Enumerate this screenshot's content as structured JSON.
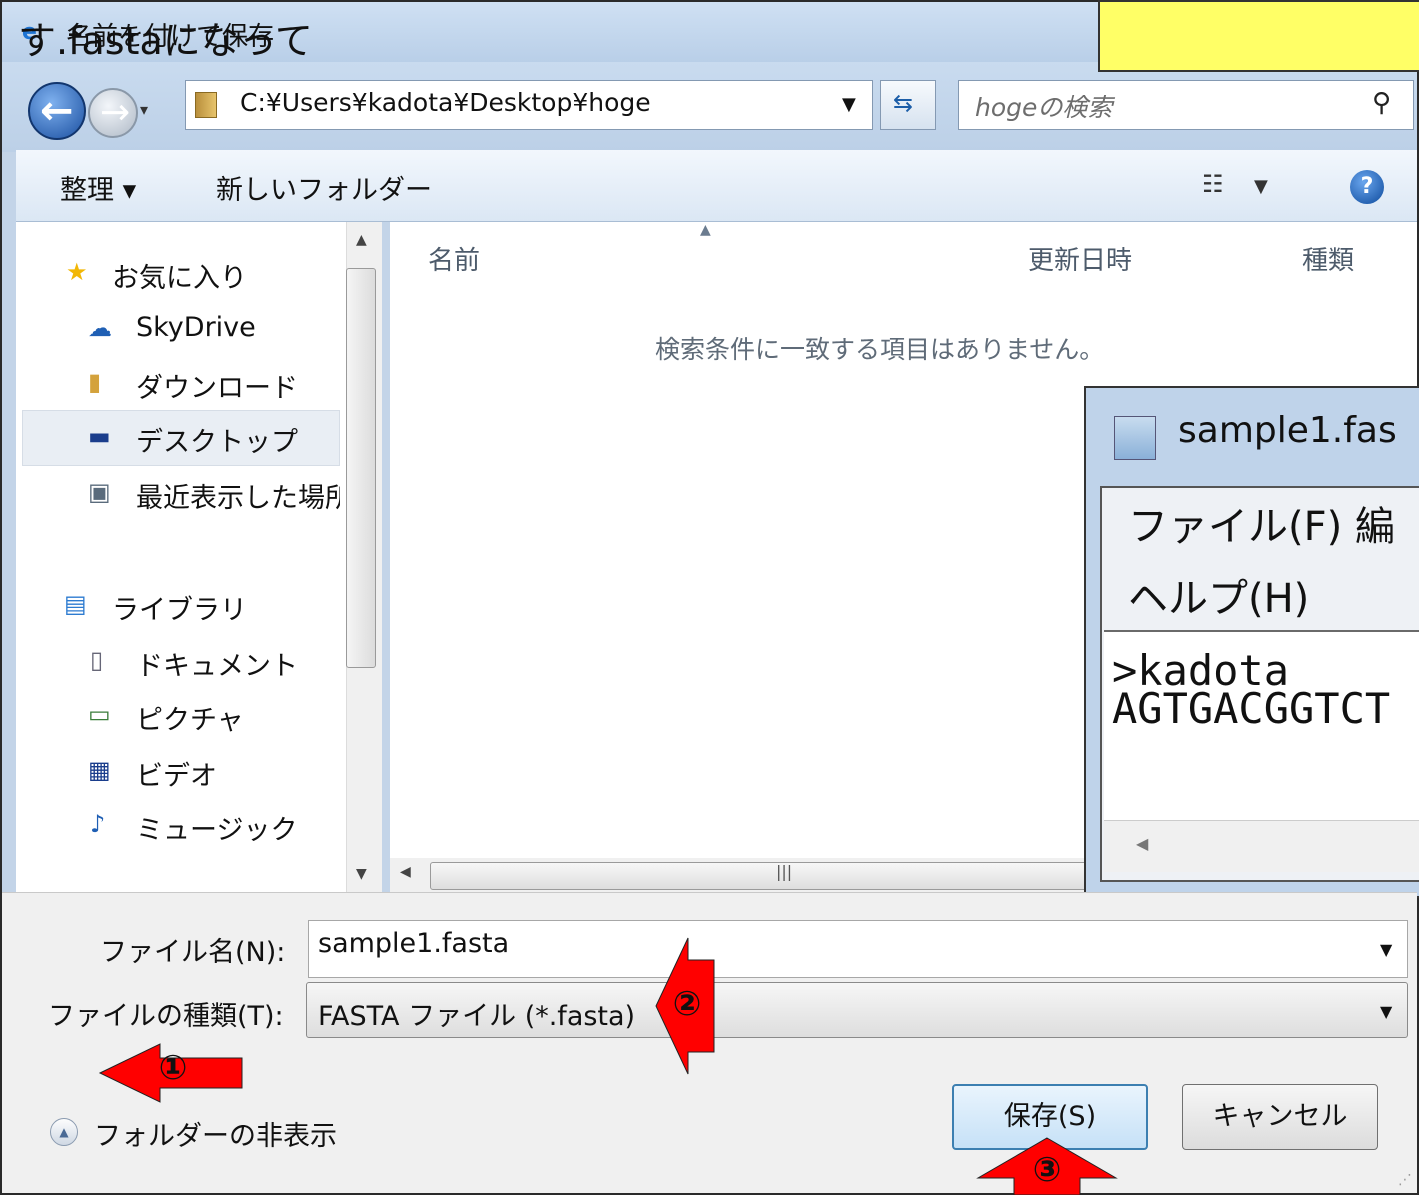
{
  "window": {
    "title": "名前を付けて保存"
  },
  "callout": {
    "text": "す.fastaになって"
  },
  "address_bar": {
    "path": "C:¥Users¥kadota¥Desktop¥hoge"
  },
  "search": {
    "placeholder": "hogeの検索"
  },
  "toolbar": {
    "organize_label": "整理 ▾",
    "new_folder_label": "新しいフォルダー"
  },
  "nav": {
    "favorites": "お気に入り",
    "items": [
      "SkyDrive",
      "ダウンロード",
      "デスクトップ",
      "最近表示した場所"
    ],
    "libraries": "ライブラリ",
    "library_items": [
      "ドキュメント",
      "ピクチャ",
      "ビデオ",
      "ミュージック"
    ],
    "selected": "デスクトップ"
  },
  "file_list": {
    "columns": [
      "名前",
      "更新日時",
      "種類"
    ],
    "empty_message": "検索条件に一致する項目はありません。"
  },
  "notepad": {
    "title": "sample1.fas",
    "menu_line1": "ファイル(F)  編",
    "menu_line2": "ヘルプ(H)",
    "content_lines": [
      ">kadota",
      "AGTGACGGTCT"
    ]
  },
  "form": {
    "filename_label": "ファイル名(N):",
    "filename_value": "sample1.fasta",
    "filetype_label": "ファイルの種類(T):",
    "filetype_value": "FASTA ファイル (*.fasta)",
    "hide_folders_label": "フォルダーの非表示",
    "save_label": "保存(S)",
    "cancel_label": "キャンセル"
  },
  "annotations": {
    "arrow1": "①",
    "arrow2": "②",
    "arrow3": "③",
    "color": "#ff0000"
  },
  "icons": [
    "ie-icon",
    "back-icon",
    "forward-icon",
    "folder-icon",
    "refresh-icon",
    "search-icon",
    "view-icon",
    "help-icon",
    "star-icon",
    "cloud-icon",
    "download-folder-icon",
    "desktop-icon",
    "recent-places-icon",
    "library-icon",
    "documents-icon",
    "pictures-icon",
    "videos-icon",
    "music-icon",
    "notepad-icon",
    "hide-folders-icon"
  ]
}
